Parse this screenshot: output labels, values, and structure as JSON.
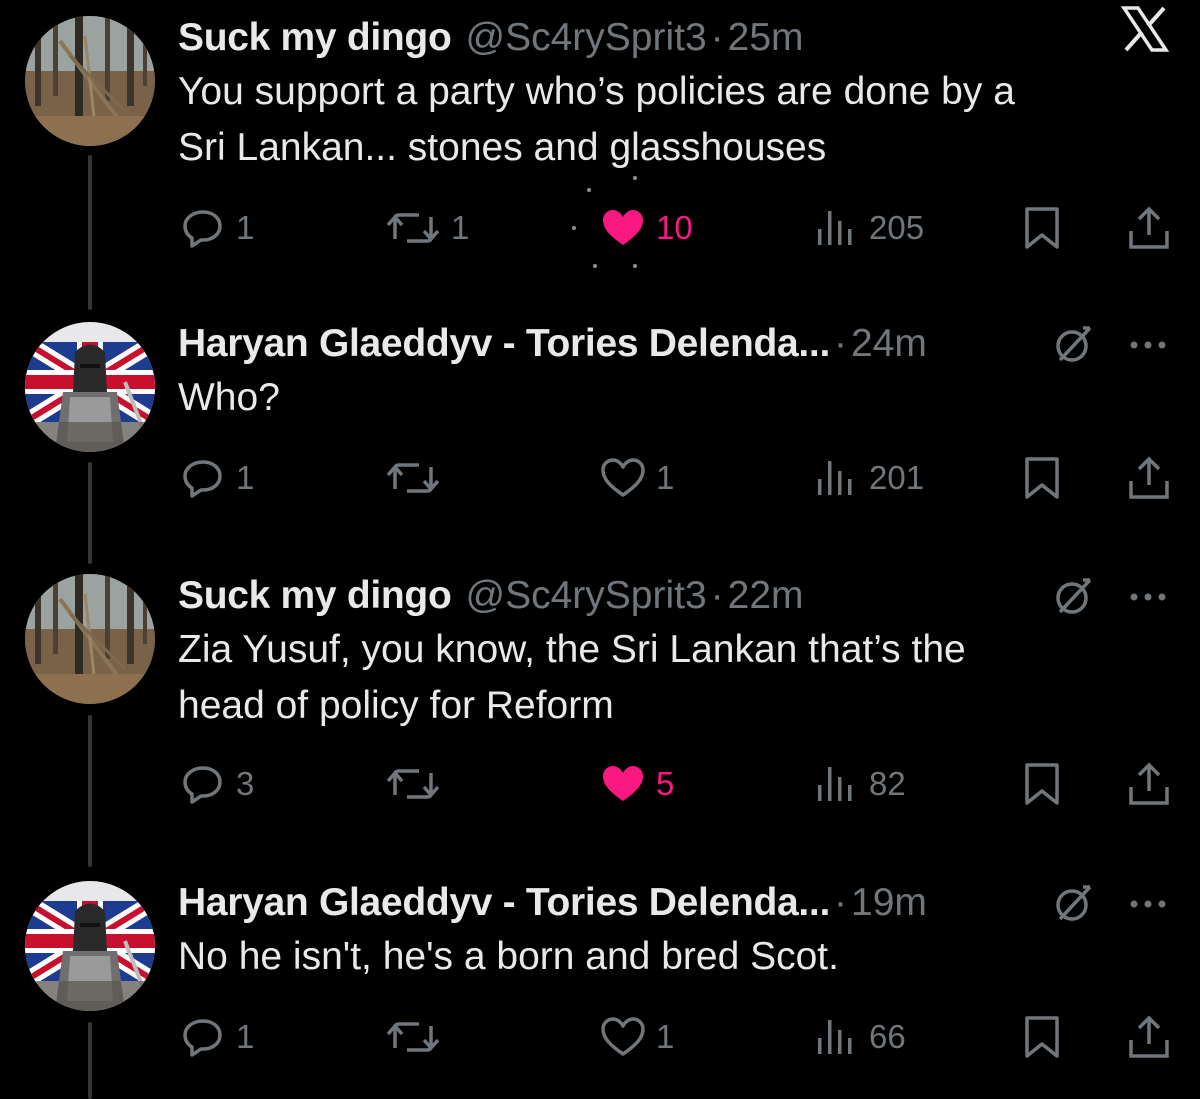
{
  "colors": {
    "background": "#000000",
    "primary_text": "#e7e9ea",
    "secondary_text": "#71767b",
    "like_pink": "#f91880",
    "thread_line": "#333639"
  },
  "header": {
    "logo_icon": "x-logo-icon"
  },
  "tweets": [
    {
      "author_name": "Suck my dingo",
      "handle": "@Sc4rySprit3",
      "separator": "·",
      "time": "25m",
      "lines": [
        "You support a party who’s policies are done by a",
        "Sri Lankan... stones and glasshouses"
      ],
      "replies": "1",
      "retweets": "1",
      "likes": "10",
      "liked": true,
      "views": "205",
      "avatar": "forest-avatar"
    },
    {
      "author_name": "Haryan Glaeddyv - Tories Delenda...",
      "separator": "·",
      "time": "24m",
      "lines": [
        "Who?"
      ],
      "replies": "1",
      "retweets": "",
      "likes": "1",
      "liked": false,
      "views": "201",
      "avatar": "union-jack-knight-avatar"
    },
    {
      "author_name": "Suck my dingo",
      "handle": "@Sc4rySprit3",
      "separator": "·",
      "time": "22m",
      "lines": [
        "Zia Yusuf, you know, the Sri Lankan that’s the",
        "head of policy for Reform"
      ],
      "replies": "3",
      "retweets": "",
      "likes": "5",
      "liked": true,
      "views": "82",
      "avatar": "forest-avatar"
    },
    {
      "author_name": "Haryan Glaeddyv - Tories Delenda...",
      "separator": "·",
      "time": "19m",
      "lines": [
        "No he isn't, he's a born and bred Scot."
      ],
      "replies": "1",
      "retweets": "",
      "likes": "1",
      "liked": false,
      "views": "66",
      "avatar": "union-jack-knight-avatar"
    }
  ]
}
